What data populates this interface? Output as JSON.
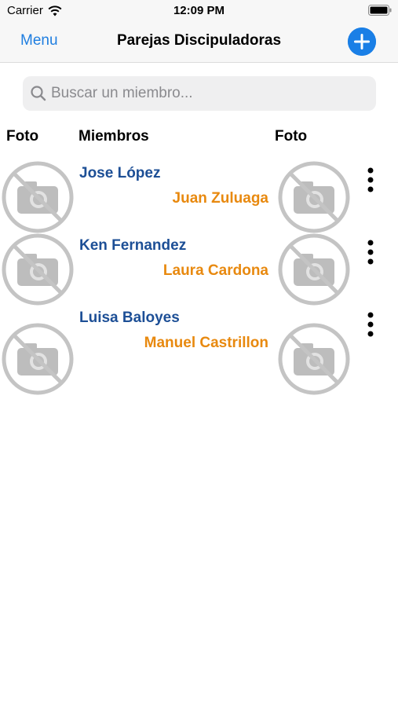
{
  "status": {
    "carrier": "Carrier",
    "time": "12:09 PM"
  },
  "nav": {
    "menu_label": "Menu",
    "title": "Parejas Discipuladoras",
    "add_icon": "plus-circle-icon",
    "accent": "#1a7fe6"
  },
  "search": {
    "placeholder": "Buscar un miembro...",
    "value": ""
  },
  "columns": {
    "photo_left": "Foto",
    "members": "Miembros",
    "photo_right": "Foto"
  },
  "rows": [
    {
      "member": "Jose López",
      "partner": "Juan Zuluaga"
    },
    {
      "member": "Ken Fernandez",
      "partner": "Laura Cardona"
    },
    {
      "member": "Luisa Baloyes",
      "partner": "Manuel Castrillon"
    }
  ],
  "colors": {
    "member": "#1d4f96",
    "partner": "#e8890f"
  }
}
